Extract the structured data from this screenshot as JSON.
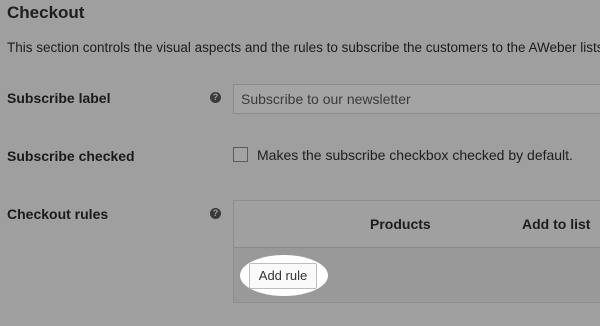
{
  "section": {
    "title": "Checkout",
    "description": "This section controls the visual aspects and the rules to subscribe the customers to the AWeber lists"
  },
  "fields": {
    "subscribe_label": {
      "label": "Subscribe label",
      "help_icon": "question-circle-icon",
      "value": "Subscribe to our newsletter"
    },
    "subscribe_checked": {
      "label": "Subscribe checked",
      "checked": false,
      "checkbox_text": "Makes the subscribe checkbox checked by default."
    },
    "checkout_rules": {
      "label": "Checkout rules",
      "help_icon": "question-circle-icon",
      "columns": [
        "Products",
        "Add to list"
      ],
      "add_rule_label": "Add rule"
    }
  },
  "colors": {
    "overlay_background": "#9f9f9f",
    "highlight": "#ffffff"
  }
}
